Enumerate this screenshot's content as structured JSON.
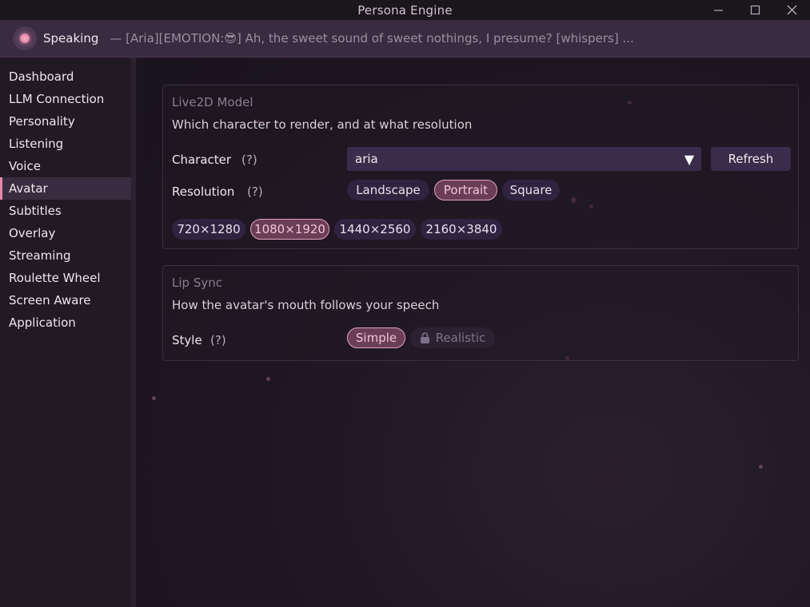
{
  "window": {
    "title": "Persona Engine"
  },
  "status": {
    "state": "Speaking",
    "message": "— [Aria][EMOTION:😎] Ah, the sweet sound of sweet nothings, I presume? [whispers] ..."
  },
  "sidebar": {
    "items": [
      {
        "label": "Dashboard"
      },
      {
        "label": "LLM Connection"
      },
      {
        "label": "Personality"
      },
      {
        "label": "Listening"
      },
      {
        "label": "Voice"
      },
      {
        "label": "Avatar",
        "active": true
      },
      {
        "label": "Subtitles"
      },
      {
        "label": "Overlay"
      },
      {
        "label": "Streaming"
      },
      {
        "label": "Roulette Wheel"
      },
      {
        "label": "Screen Aware"
      },
      {
        "label": "Application"
      }
    ]
  },
  "live2d": {
    "title": "Live2D Model",
    "description": "Which character to render, and at what resolution",
    "character_label": "Character",
    "character_help": "(?)",
    "character_value": "aria",
    "refresh_label": "Refresh",
    "resolution_label": "Resolution",
    "resolution_help": "(?)",
    "orientations": [
      {
        "label": "Landscape",
        "selected": false
      },
      {
        "label": "Portrait",
        "selected": true
      },
      {
        "label": "Square",
        "selected": false
      }
    ],
    "sizes": [
      {
        "label": "720×1280",
        "selected": false
      },
      {
        "label": "1080×1920",
        "selected": true
      },
      {
        "label": "1440×2560",
        "selected": false
      },
      {
        "label": "2160×3840",
        "selected": false
      }
    ]
  },
  "lipsync": {
    "title": "Lip Sync",
    "description": "How the avatar's mouth follows your speech",
    "style_label": "Style",
    "style_help": "(?)",
    "styles": [
      {
        "label": "Simple",
        "selected": true,
        "locked": false
      },
      {
        "label": "Realistic",
        "selected": false,
        "locked": true
      }
    ]
  },
  "colors": {
    "accent": "#e08aa8",
    "selected_chip_bg": "#6a3e56",
    "chip_bg": "#2e2440"
  }
}
